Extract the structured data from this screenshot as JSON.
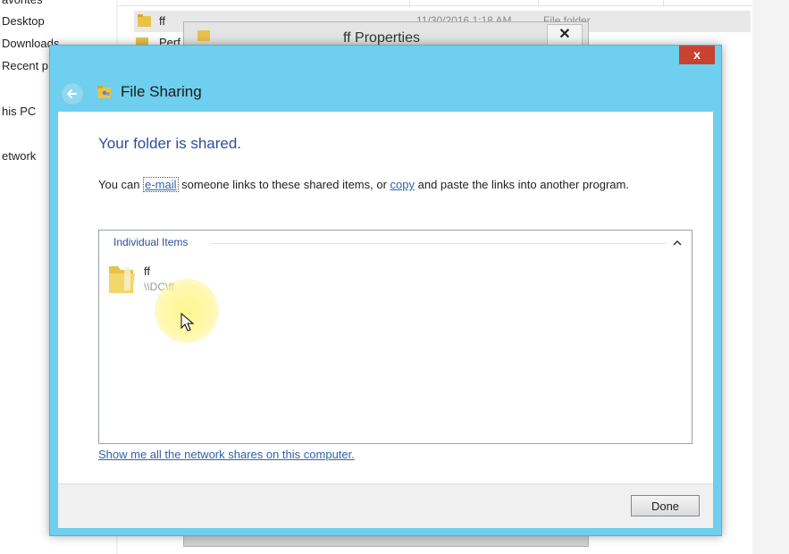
{
  "explorer": {
    "nav": [
      "avorites",
      "Desktop",
      "Downloads",
      "Recent p",
      "his PC",
      "etwork"
    ],
    "row1": {
      "name": "ff",
      "date": "11/30/2016 1:18 AM",
      "type": "File folder"
    },
    "row2": {
      "name": "Perf"
    }
  },
  "properties": {
    "title": "ff Properties",
    "close": "✕"
  },
  "file_sharing": {
    "title": "File Sharing",
    "close": "x",
    "heading": "Your folder is shared.",
    "desc_before": "You can ",
    "email_link": "e-mail",
    "desc_mid": " someone links to these shared items, or ",
    "copy_link": "copy",
    "desc_after": " and paste the links into another program.",
    "group_label": "Individual Items",
    "collapse": "^",
    "item": {
      "name": "ff",
      "path": "\\\\DC\\ff"
    },
    "show_shares_link": "Show me all the network shares on this computer.",
    "done": "Done"
  },
  "colors": {
    "title_bar": "#6ecfee",
    "close_red": "#c9422f",
    "heading_blue": "#2f4d9c",
    "link_blue": "#2f63b0"
  }
}
